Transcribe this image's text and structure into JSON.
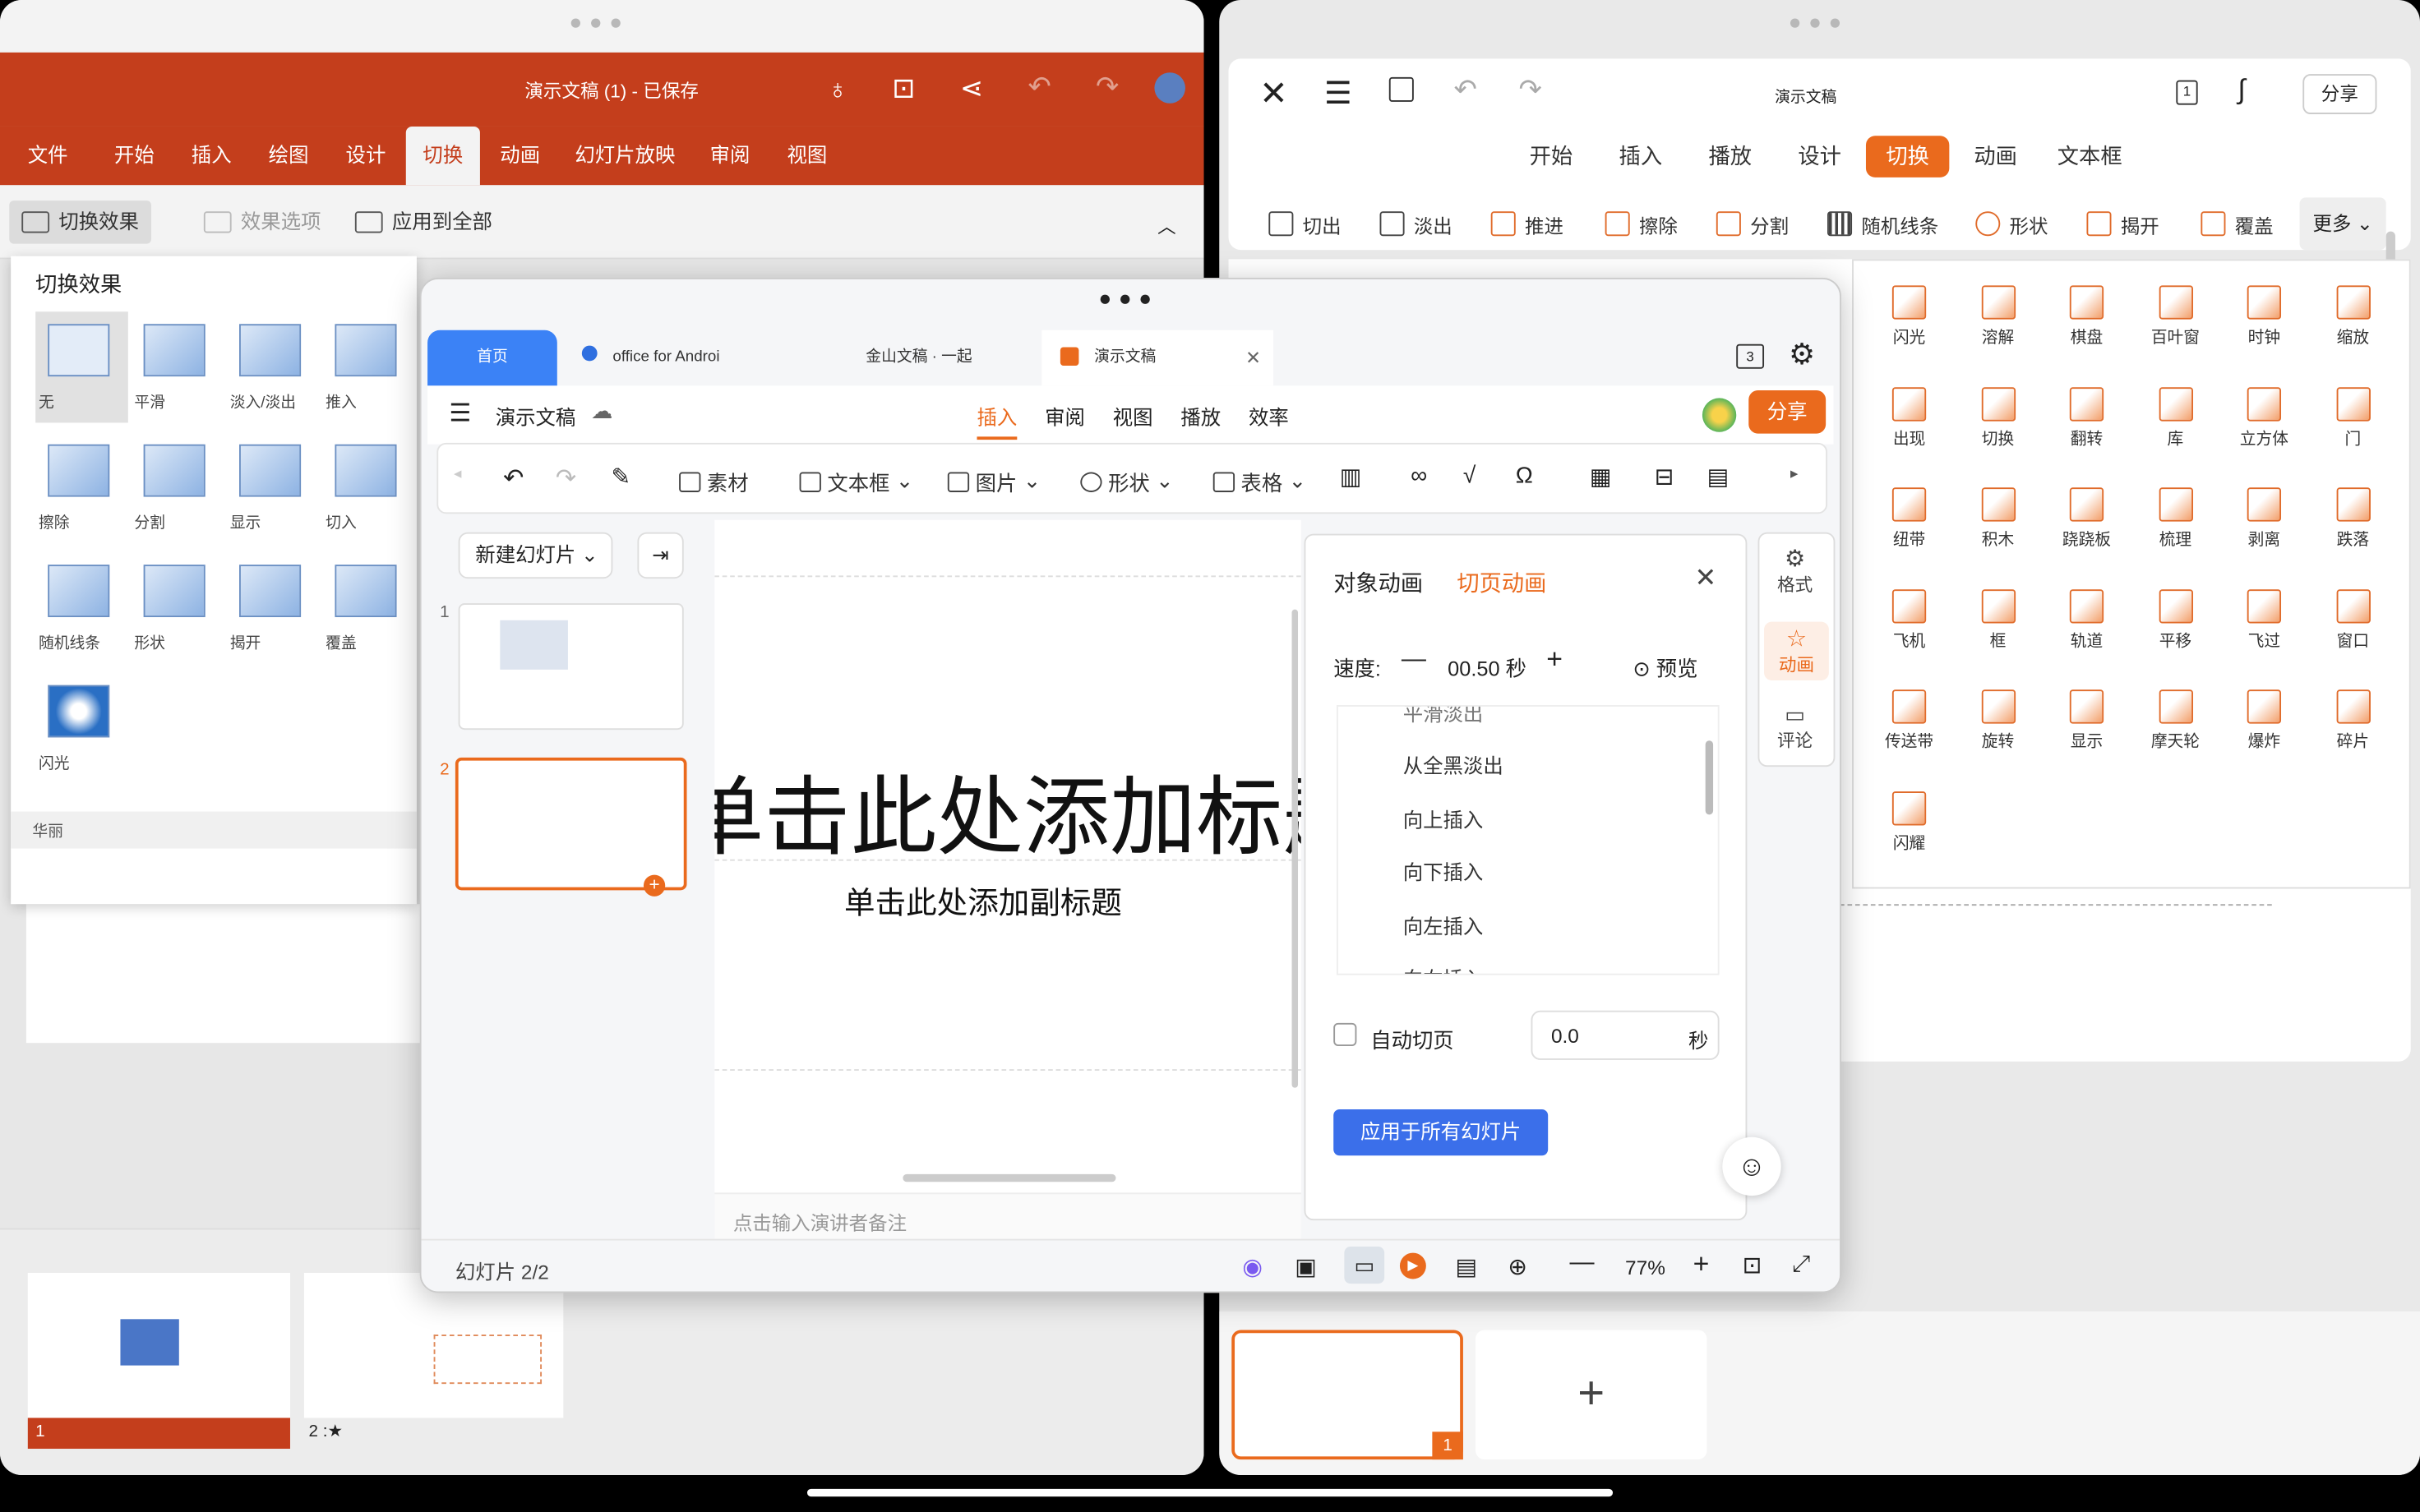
{
  "left": {
    "title": "演示文稿 (1) - 已保存",
    "tabs": [
      "文件",
      "开始",
      "插入",
      "绘图",
      "设计",
      "切换",
      "动画",
      "幻灯片放映",
      "审阅",
      "视图"
    ],
    "active_tab": "切换",
    "ribbon": {
      "effect": "切换效果",
      "options": "效果选项",
      "apply_all": "应用到全部"
    },
    "panel": {
      "title": "切换效果",
      "items": [
        "无",
        "平滑",
        "淡入/淡出",
        "推入",
        "擦除",
        "分割",
        "显示",
        "切入",
        "随机线条",
        "形状",
        "揭开",
        "覆盖",
        "闪光"
      ],
      "section": "华丽"
    },
    "slides": [
      "1",
      "2 :★"
    ]
  },
  "middle": {
    "tabs": [
      "首页",
      "office for Androi",
      "金山文稿 · 一起",
      "演示文稿"
    ],
    "tab_count": "3",
    "doc_title": "演示文稿",
    "menu": [
      "插入",
      "审阅",
      "视图",
      "播放",
      "效率"
    ],
    "share": "分享",
    "tools": [
      "素材",
      "文本框",
      "图片",
      "形状",
      "表格"
    ],
    "new_slide": "新建幻灯片",
    "slide_nums": [
      "1",
      "2"
    ],
    "title_text": "单击此处添加标题",
    "subtitle_text": "单击此处添加副标题",
    "notes": "点击输入演讲者备注",
    "anim": {
      "tab1": "对象动画",
      "tab2": "切页动画",
      "speed_label": "速度:",
      "speed_value": "00.50 秒",
      "preview": "预览",
      "list": [
        "平滑淡出",
        "从全黑淡出",
        "向上插入",
        "向下插入",
        "向左插入",
        "向右插入"
      ],
      "auto": "自动切页",
      "auto_value": "0.0",
      "auto_unit": "秒",
      "apply": "应用于所有幻灯片"
    },
    "side": [
      "格式",
      "动画",
      "评论"
    ],
    "status": "幻灯片 2/2",
    "zoom": "77%"
  },
  "right": {
    "title": "演示文稿",
    "share": "分享",
    "page_num": "1",
    "tabs": [
      "开始",
      "插入",
      "播放",
      "设计",
      "切换",
      "动画",
      "文本框"
    ],
    "active_tab": "切换",
    "tools": [
      "切出",
      "淡出",
      "推进",
      "擦除",
      "分割",
      "随机线条",
      "形状",
      "揭开",
      "覆盖"
    ],
    "more": "更多",
    "grid": [
      "闪光",
      "溶解",
      "棋盘",
      "百叶窗",
      "时钟",
      "缩放",
      "出现",
      "切换",
      "翻转",
      "库",
      "立方体",
      "门",
      "纽带",
      "积木",
      "跷跷板",
      "梳理",
      "剥离",
      "跌落",
      "飞机",
      "框",
      "轨道",
      "平移",
      "飞过",
      "窗口",
      "传送带",
      "旋转",
      "显示",
      "摩天轮",
      "爆炸",
      "碎片",
      "闪耀"
    ],
    "slide_badge": "1",
    "add": "+"
  },
  "colors": {
    "office_red": "#c43e1c",
    "wps_orange": "#ea6a1d",
    "wps_blue": "#3b6fea"
  }
}
